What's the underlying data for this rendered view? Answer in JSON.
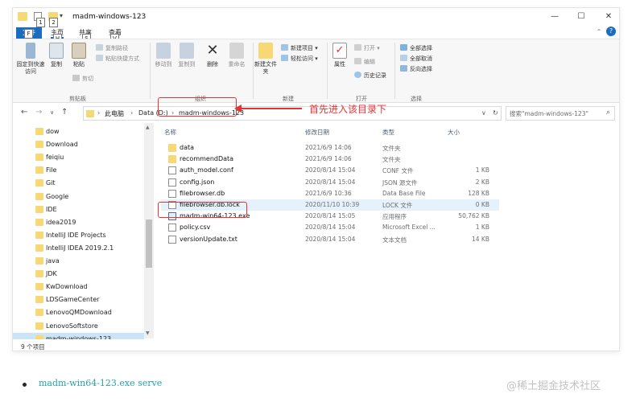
{
  "window": {
    "title": "madm-windows-123",
    "keytips": [
      "1",
      "2",
      "H",
      "S",
      "V",
      "F"
    ],
    "controls": {
      "minimize": "—",
      "maximize": "☐",
      "close": "✕",
      "help": "?"
    }
  },
  "ribbon_tabs": {
    "file": "文件",
    "home": "主页",
    "share": "共享",
    "view": "查看"
  },
  "ribbon": {
    "pin_quick_access": "固定到快速访问",
    "copy": "复制",
    "paste": "粘贴",
    "copy_path": "复制路径",
    "paste_shortcut": "粘贴快捷方式",
    "cut": "剪切",
    "move_to": "移动到",
    "copy_to": "复制到",
    "delete": "删除",
    "rename": "重命名",
    "new_item": "新建项目",
    "easy_access": "轻松访问",
    "new_folder": "新建文件夹",
    "properties": "属性",
    "open": "打开",
    "edit": "编辑",
    "history": "历史记录",
    "select_all": "全部选择",
    "select_none": "全部取消",
    "invert_selection": "反向选择",
    "groups": {
      "clipboard": "剪贴板",
      "organize": "组织",
      "new": "新建",
      "open": "打开",
      "select": "选择"
    }
  },
  "address": {
    "crumbs": [
      "此电脑",
      "Data (D:)",
      "madm-windows-123"
    ],
    "search_placeholder": "搜索\"madm-windows-123\""
  },
  "nav": {
    "items": [
      "dow",
      "Download",
      "feiqiu",
      "File",
      "Git",
      "Google",
      "IDE",
      "idea2019",
      "IntelliJ IDE Projects",
      "IntelliJ IDEA 2019.2.1",
      "java",
      "JDK",
      "KwDownload",
      "LDSGameCenter",
      "LenovoQMDownload",
      "LenovoSoftstore",
      "madm-windows-123"
    ],
    "selected": "madm-windows-123"
  },
  "files": {
    "headers": {
      "name": "名称",
      "date": "修改日期",
      "type": "类型",
      "size": "大小"
    },
    "rows": [
      {
        "name": "data",
        "date": "2021/6/9 14:06",
        "type": "文件夹",
        "size": "",
        "icon": "folder"
      },
      {
        "name": "recommendData",
        "date": "2021/6/9 14:06",
        "type": "文件夹",
        "size": "",
        "icon": "folder"
      },
      {
        "name": "auth_model.conf",
        "date": "2020/8/14 15:04",
        "type": "CONF 文件",
        "size": "1 KB",
        "icon": "doc"
      },
      {
        "name": "config.json",
        "date": "2020/8/14 15:04",
        "type": "JSON 源文件",
        "size": "2 KB",
        "icon": "doc"
      },
      {
        "name": "filebrowser.db",
        "date": "2021/6/9 10:36",
        "type": "Data Base File",
        "size": "128 KB",
        "icon": "doc"
      },
      {
        "name": "filebrowser.db.lock",
        "date": "2020/11/10 10:39",
        "type": "LOCK 文件",
        "size": "0 KB",
        "icon": "doc"
      },
      {
        "name": "madm-win64-123.exe",
        "date": "2020/8/14 15:05",
        "type": "应用程序",
        "size": "50,762 KB",
        "icon": "exe"
      },
      {
        "name": "policy.csv",
        "date": "2020/8/14 15:04",
        "type": "Microsoft Excel ...",
        "size": "1 KB",
        "icon": "doc"
      },
      {
        "name": "versionUpdate.txt",
        "date": "2020/8/14 15:04",
        "type": "文本文档",
        "size": "14 KB",
        "icon": "doc"
      }
    ]
  },
  "status": {
    "count_text": "9 个项目"
  },
  "annotation": {
    "text": "首先进入该目录下",
    "color": "#e53333"
  },
  "bullet": {
    "text": "madm-win64-123.exe serve"
  },
  "watermark": "@稀土掘金技术社区",
  "colors": {
    "accent": "#1a6dc0",
    "folder": "#f8d775",
    "selection": "#cce4f7",
    "link_text": "#27a0aa"
  }
}
